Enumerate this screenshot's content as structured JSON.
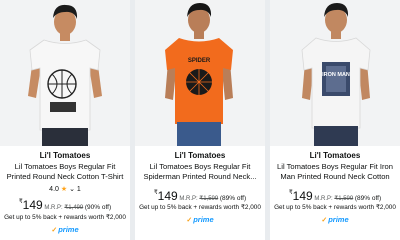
{
  "products": [
    {
      "brand": "Li'l Tomatoes",
      "title": "Lil Tomatoes Boys Regular Fit Printed Round Neck Cotton T-Shirt White",
      "rating": "4.0",
      "reviews": "1",
      "currency": "₹",
      "price": "149",
      "mrp_label": "M.R.P:",
      "mrp": "₹1,499",
      "discount": "(90% off)",
      "cashback": "Get up to 5% back + rewards worth ₹2,000",
      "badge": "prime",
      "shirt_color": "#f7f7f7",
      "print_text": ""
    },
    {
      "brand": "Li'l Tomatoes",
      "title": "Lil Tomatoes Boys Regular Fit Spiderman Printed Round Neck...",
      "rating": "",
      "reviews": "",
      "currency": "₹",
      "price": "149",
      "mrp_label": "M.R.P:",
      "mrp": "₹1,599",
      "discount": "(89% off)",
      "cashback": "Get up to 5% back + rewards worth ₹2,000",
      "badge": "prime",
      "shirt_color": "#f26b1d",
      "print_text": "SPIDER"
    },
    {
      "brand": "Li'l Tomatoes",
      "title": "Lil Tomatoes Boys Regular Fit Iron Man Printed Round Neck Cotton T-...",
      "rating": "",
      "reviews": "",
      "currency": "₹",
      "price": "149",
      "mrp_label": "M.R.P:",
      "mrp": "₹1,599",
      "discount": "(89% off)",
      "cashback": "Get up to 5% back + rewards worth ₹2,000",
      "badge": "prime",
      "shirt_color": "#f5f5f5",
      "print_text": "IRON MAN"
    }
  ],
  "colors": {
    "prime_blue": "#1399ff",
    "star": "#ffa41c",
    "text": "#0f1111",
    "muted": "#565959"
  }
}
